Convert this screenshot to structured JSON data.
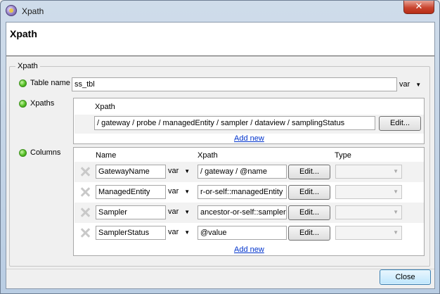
{
  "window": {
    "title": "Xpath",
    "close_glyph": "✕"
  },
  "header": {
    "title": "Xpath"
  },
  "group": {
    "legend": "Xpath"
  },
  "table_name": {
    "label": "Table name",
    "value": "ss_tbl",
    "var": "var"
  },
  "xpaths": {
    "label": "Xpaths",
    "column_header": "Xpath",
    "value": "/ gateway / probe / managedEntity / sampler / dataview / samplingStatus",
    "edit_label": "Edit...",
    "add_new": "Add new"
  },
  "columns": {
    "label": "Columns",
    "headers": {
      "name": "Name",
      "xpath": "Xpath",
      "type": "Type"
    },
    "rows": [
      {
        "name": "GatewayName",
        "var": "var",
        "xpath": "/ gateway / @name",
        "edit": "Edit..."
      },
      {
        "name": "ManagedEntity",
        "var": "var",
        "xpath": "r-or-self::managedEntity",
        "edit": "Edit..."
      },
      {
        "name": "Sampler",
        "var": "var",
        "xpath": "ancestor-or-self::sampler",
        "edit": "Edit..."
      },
      {
        "name": "SamplerStatus",
        "var": "var",
        "xpath": "@value",
        "edit": "Edit..."
      }
    ],
    "add_new": "Add new"
  },
  "footer": {
    "close_label": "Close"
  },
  "arrow_glyph": "▼"
}
